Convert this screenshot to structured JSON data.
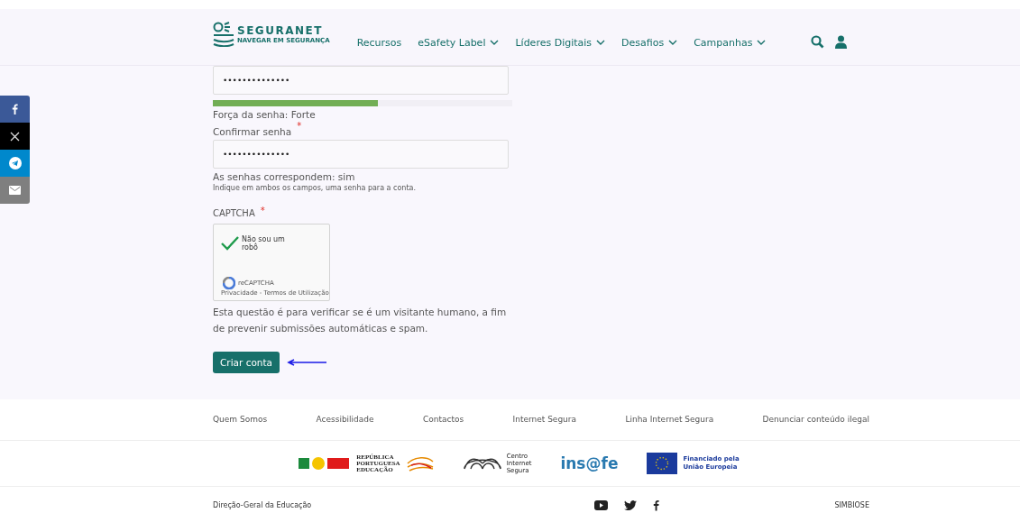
{
  "header": {
    "logo": {
      "name": "SEGURANET",
      "tagline": "NAVEGAR EM SEGURANÇA"
    },
    "nav": [
      {
        "label": "Recursos",
        "dropdown": false
      },
      {
        "label": "eSafety Label",
        "dropdown": true
      },
      {
        "label": "Líderes Digitais",
        "dropdown": true
      },
      {
        "label": "Desafios",
        "dropdown": true
      },
      {
        "label": "Campanhas",
        "dropdown": true
      }
    ]
  },
  "share": [
    {
      "kind": "facebook",
      "color": "#3b5998"
    },
    {
      "kind": "x",
      "color": "#000000"
    },
    {
      "kind": "telegram",
      "color": "#0088cc"
    },
    {
      "kind": "email",
      "color": "#7f7f7f"
    }
  ],
  "form": {
    "password": {
      "value": "••••••••••••••",
      "strength": {
        "level": 0.55,
        "label": "Força da senha: Forte"
      }
    },
    "confirm": {
      "label": "Confirmar senha",
      "required_mark": "*",
      "value": "••••••••••••••",
      "match": "As senhas correspondem: sim",
      "hint": "Indique em ambos os campos, uma senha para a conta."
    },
    "captcha": {
      "label": "CAPTCHA",
      "required_mark": "*",
      "checked": true,
      "text": "Não sou um robô",
      "brand": "reCAPTCHA",
      "links": "Privacidade - Termos de Utilização",
      "description": "Esta questão é para verificar se é um visitante humano, a fim de prevenir submissões automáticas e spam."
    },
    "submit": "Criar conta",
    "annotation_arrow": true
  },
  "footer": {
    "links": [
      "Quem Somos",
      "Acessibilidade",
      "Contactos",
      "Internet Segura",
      "Linha Internet Segura",
      "Denunciar conteúdo ilegal"
    ],
    "logos": [
      {
        "kind": "republica",
        "lines": [
          "REPÚBLICA",
          "PORTUGUESA",
          "EDUCAÇÃO"
        ]
      },
      {
        "kind": "cis",
        "lines": [
          "Centro",
          "Internet",
          "Segura"
        ]
      },
      {
        "kind": "insafe",
        "lines": [
          "ins@fe"
        ]
      },
      {
        "kind": "eu",
        "lines": [
          "Financiado pela",
          "União Europeia"
        ]
      }
    ],
    "left": "Direção-Geral da Educação",
    "right": "SIMBIOSE"
  }
}
